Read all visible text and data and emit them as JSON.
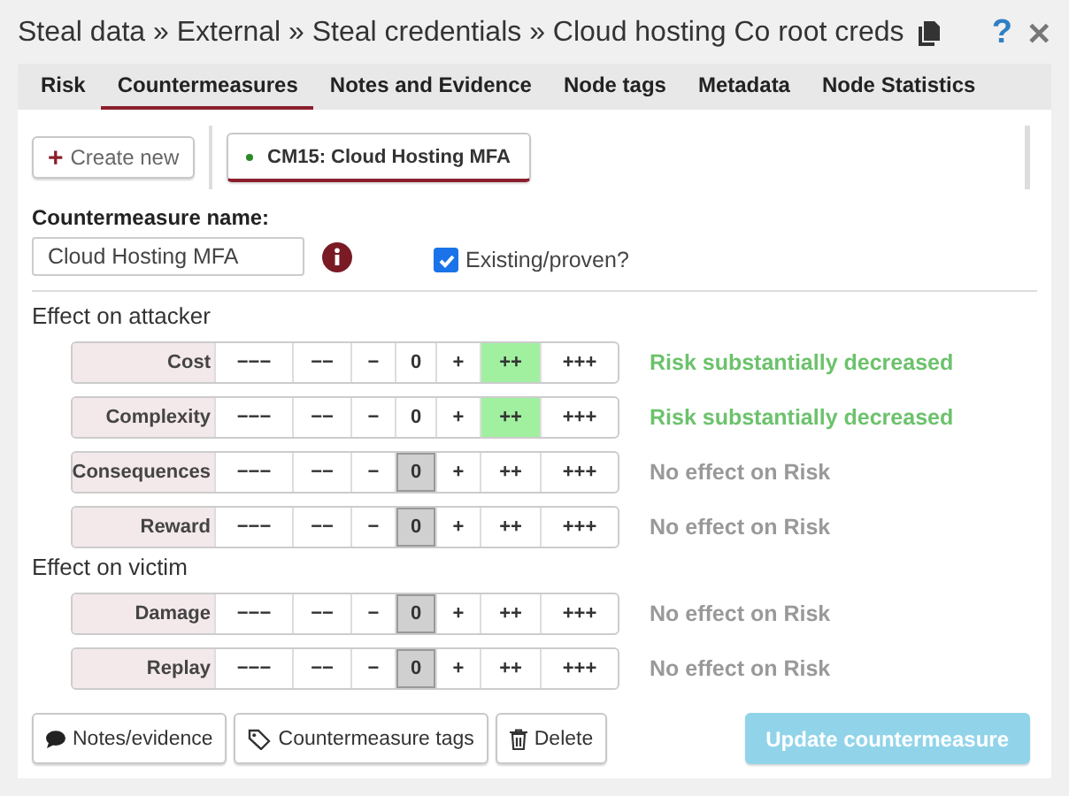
{
  "title": "Steal data » External » Steal credentials » Cloud hosting Co root creds",
  "tabs": [
    {
      "label": "Risk",
      "selected": false
    },
    {
      "label": "Countermeasures",
      "selected": true
    },
    {
      "label": "Notes and Evidence",
      "selected": false
    },
    {
      "label": "Node tags",
      "selected": false
    },
    {
      "label": "Metadata",
      "selected": false
    },
    {
      "label": "Node Statistics",
      "selected": false
    }
  ],
  "create_button": {
    "icon": "+",
    "label": "Create new"
  },
  "countermeasures": [
    {
      "label": "CM15: Cloud Hosting MFA",
      "selected": true,
      "color": "#2a8a2a"
    }
  ],
  "name_label": "Countermeasure name:",
  "name_value": "Cloud Hosting MFA",
  "existing": {
    "label": "Existing/proven?",
    "checked": true
  },
  "sections": [
    {
      "title": "Effect on attacker",
      "rows": [
        {
          "label": "Cost",
          "kind": "decrease",
          "result": "Risk substantially decreased",
          "options": [
            {
              "label": "−−−",
              "selected": false
            },
            {
              "label": "−−",
              "selected": false
            },
            {
              "label": "−",
              "selected": false
            },
            {
              "label": "0",
              "selected": false
            },
            {
              "label": "+",
              "selected": false
            },
            {
              "label": "++",
              "selected": true
            },
            {
              "label": "+++",
              "selected": false
            }
          ]
        },
        {
          "label": "Complexity",
          "kind": "decrease",
          "result": "Risk substantially decreased",
          "options": [
            {
              "label": "−−−",
              "selected": false
            },
            {
              "label": "−−",
              "selected": false
            },
            {
              "label": "−",
              "selected": false
            },
            {
              "label": "0",
              "selected": false
            },
            {
              "label": "+",
              "selected": false
            },
            {
              "label": "++",
              "selected": true
            },
            {
              "label": "+++",
              "selected": false
            }
          ]
        },
        {
          "label": "Consequences",
          "kind": "none",
          "result": "No effect on Risk",
          "options": [
            {
              "label": "−−−",
              "selected": false
            },
            {
              "label": "−−",
              "selected": false
            },
            {
              "label": "−",
              "selected": false
            },
            {
              "label": "0",
              "selected": true
            },
            {
              "label": "+",
              "selected": false
            },
            {
              "label": "++",
              "selected": false
            },
            {
              "label": "+++",
              "selected": false
            }
          ]
        },
        {
          "label": "Reward",
          "kind": "none",
          "result": "No effect on Risk",
          "options": [
            {
              "label": "−−−",
              "selected": false
            },
            {
              "label": "−−",
              "selected": false
            },
            {
              "label": "−",
              "selected": false
            },
            {
              "label": "0",
              "selected": true
            },
            {
              "label": "+",
              "selected": false
            },
            {
              "label": "++",
              "selected": false
            },
            {
              "label": "+++",
              "selected": false
            }
          ]
        }
      ]
    },
    {
      "title": "Effect on victim",
      "rows": [
        {
          "label": "Damage",
          "kind": "none",
          "result": "No effect on Risk",
          "options": [
            {
              "label": "−−−",
              "selected": false
            },
            {
              "label": "−−",
              "selected": false
            },
            {
              "label": "−",
              "selected": false
            },
            {
              "label": "0",
              "selected": true
            },
            {
              "label": "+",
              "selected": false
            },
            {
              "label": "++",
              "selected": false
            },
            {
              "label": "+++",
              "selected": false
            }
          ]
        },
        {
          "label": "Replay",
          "kind": "none",
          "result": "No effect on Risk",
          "options": [
            {
              "label": "−−−",
              "selected": false
            },
            {
              "label": "−−",
              "selected": false
            },
            {
              "label": "−",
              "selected": false
            },
            {
              "label": "0",
              "selected": true
            },
            {
              "label": "+",
              "selected": false
            },
            {
              "label": "++",
              "selected": false
            },
            {
              "label": "+++",
              "selected": false
            }
          ]
        }
      ]
    }
  ],
  "buttons": [
    {
      "kind": "notes",
      "label": "Notes/evidence"
    },
    {
      "kind": "tags",
      "label": "Countermeasure tags"
    },
    {
      "kind": "delete",
      "label": "Delete"
    }
  ],
  "update_button": {
    "label": "Update countermeasure",
    "disabled": true
  },
  "help": "?",
  "close": "✕"
}
